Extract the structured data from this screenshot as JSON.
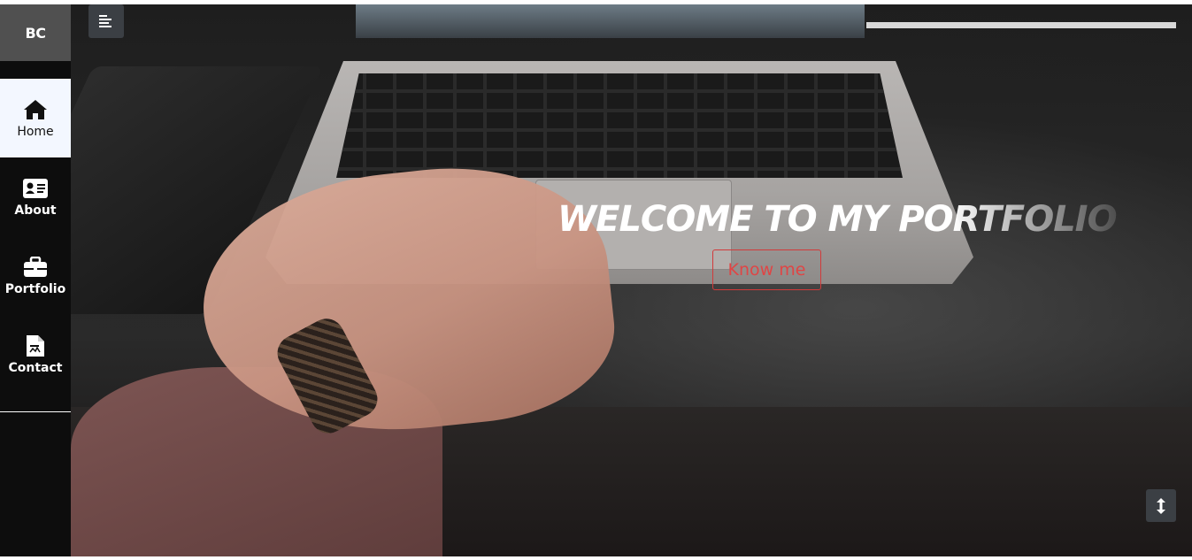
{
  "sidebar": {
    "brand": "BC",
    "items": [
      {
        "label": "Home",
        "icon": "home-icon",
        "active": true
      },
      {
        "label": "About",
        "icon": "id-card-icon",
        "active": false
      },
      {
        "label": "Portfolio",
        "icon": "briefcase-icon",
        "active": false
      },
      {
        "label": "Contact",
        "icon": "document-icon",
        "active": false
      }
    ]
  },
  "hero": {
    "headline": "WELCOME TO MY PORTFOLIO",
    "cta_label": "Know me",
    "menu_icon": "menu-icon",
    "scroll_icon": "scroll-arrows-icon"
  },
  "colors": {
    "accent": "#e04545",
    "sidebar_bg": "#0d0d0d",
    "brand_bg": "#505050",
    "active_bg": "#f3f7ff",
    "button_bg": "#3b3f44"
  }
}
